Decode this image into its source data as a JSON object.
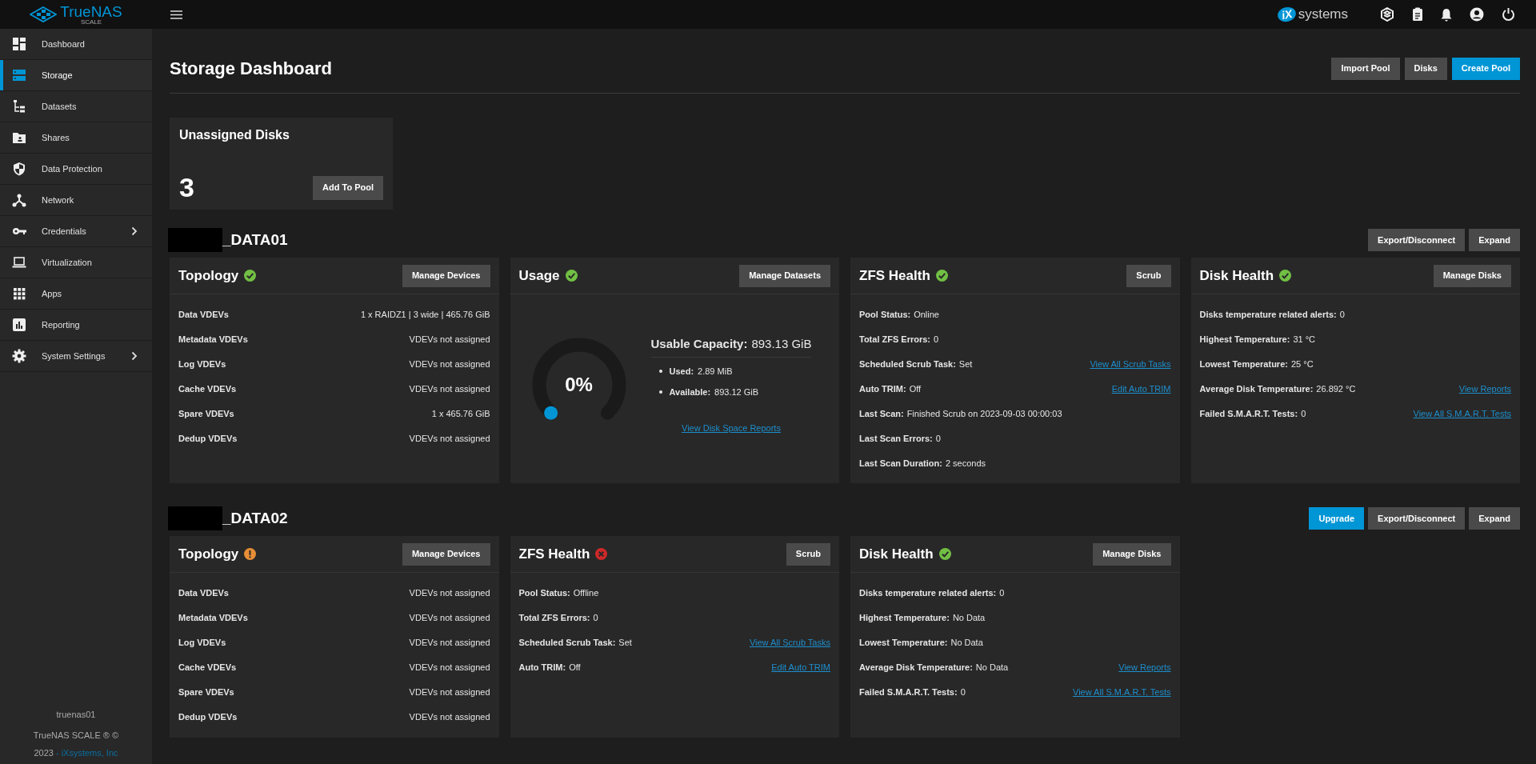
{
  "topbar": {
    "logo": "TrueNAS",
    "logo_sub": "SCALE",
    "vendor_mark": "iX",
    "vendor": "systems"
  },
  "sidebar": {
    "items": [
      {
        "label": "Dashboard",
        "kind": "dashboard",
        "selected": false,
        "has_submenu": false
      },
      {
        "label": "Storage",
        "kind": "storage",
        "selected": true,
        "has_submenu": false
      },
      {
        "label": "Datasets",
        "kind": "datasets",
        "selected": false,
        "has_submenu": false
      },
      {
        "label": "Shares",
        "kind": "shares",
        "selected": false,
        "has_submenu": false
      },
      {
        "label": "Data Protection",
        "kind": "protection",
        "selected": false,
        "has_submenu": false
      },
      {
        "label": "Network",
        "kind": "network",
        "selected": false,
        "has_submenu": false
      },
      {
        "label": "Credentials",
        "kind": "credentials",
        "selected": false,
        "has_submenu": true
      },
      {
        "label": "Virtualization",
        "kind": "virtualization",
        "selected": false,
        "has_submenu": false
      },
      {
        "label": "Apps",
        "kind": "apps",
        "selected": false,
        "has_submenu": false
      },
      {
        "label": "Reporting",
        "kind": "reporting",
        "selected": false,
        "has_submenu": false
      },
      {
        "label": "System Settings",
        "kind": "settings",
        "selected": false,
        "has_submenu": true
      }
    ],
    "hostname": "truenas01",
    "copyright": "TrueNAS SCALE ® ©",
    "year": "2023",
    "company": "- iXsystems, Inc"
  },
  "page": {
    "title": "Storage Dashboard",
    "actions": [
      {
        "label": "Import Pool",
        "primary": false
      },
      {
        "label": "Disks",
        "primary": false
      },
      {
        "label": "Create Pool",
        "primary": true
      }
    ]
  },
  "unassigned": {
    "title": "Unassigned Disks",
    "count": "3",
    "action": "Add To Pool"
  },
  "pools": [
    {
      "name": "_DATA01",
      "redacted": true,
      "actions": [
        {
          "label": "Export/Disconnect",
          "primary": false
        },
        {
          "label": "Expand",
          "primary": false
        }
      ],
      "cards": [
        {
          "kind": "topology",
          "title": "Topology",
          "status": {
            "kind": "ok"
          },
          "button": "Manage Devices",
          "rows": [
            {
              "label": "Data VDEVs",
              "value": "1 x RAIDZ1 | 3 wide | 465.76 GiB"
            },
            {
              "label": "Metadata VDEVs",
              "value": "VDEVs not assigned"
            },
            {
              "label": "Log VDEVs",
              "value": "VDEVs not assigned"
            },
            {
              "label": "Cache VDEVs",
              "value": "VDEVs not assigned"
            },
            {
              "label": "Spare VDEVs",
              "value": "1 x 465.76 GiB"
            },
            {
              "label": "Dedup VDEVs",
              "value": "VDEVs not assigned"
            }
          ]
        },
        {
          "kind": "usage",
          "title": "Usage",
          "status": {
            "kind": "ok"
          },
          "button": "Manage Datasets",
          "gauge": {
            "text": "0%"
          },
          "capacity_label": "Usable Capacity:",
          "capacity": "893.13 GiB",
          "items": [
            {
              "label": "Used:",
              "value": "2.89 MiB"
            },
            {
              "label": "Available:",
              "value": "893.12 GiB"
            }
          ],
          "link": "View Disk Space Reports"
        },
        {
          "kind": "health",
          "title": "ZFS Health",
          "status": {
            "kind": "ok"
          },
          "button": "Scrub",
          "rows": [
            {
              "label": "Pool Status:",
              "value": "Online"
            },
            {
              "label": "Total ZFS Errors:",
              "value": "0"
            },
            {
              "label": "Scheduled Scrub Task:",
              "value": "Set",
              "link": "View All Scrub Tasks"
            },
            {
              "label": "Auto TRIM:",
              "value": "Off",
              "link": "Edit Auto TRIM"
            },
            {
              "label": "Last Scan:",
              "value": "Finished Scrub on 2023-09-03 00:00:03"
            },
            {
              "label": "Last Scan Errors:",
              "value": "0"
            },
            {
              "label": "Last Scan Duration:",
              "value": "2 seconds"
            }
          ]
        },
        {
          "kind": "health",
          "title": "Disk Health",
          "status": {
            "kind": "ok"
          },
          "button": "Manage Disks",
          "rows": [
            {
              "label": "Disks temperature related alerts:",
              "value": "0"
            },
            {
              "label": "Highest Temperature:",
              "value": "31 °C"
            },
            {
              "label": "Lowest Temperature:",
              "value": "25 °C"
            },
            {
              "label": "Average Disk Temperature:",
              "value": "26.892 °C",
              "link": "View Reports"
            },
            {
              "label": "Failed S.M.A.R.T. Tests:",
              "value": "0",
              "link": "View All S.M.A.R.T. Tests"
            }
          ]
        }
      ]
    },
    {
      "name": "_DATA02",
      "redacted": true,
      "actions": [
        {
          "label": "Upgrade",
          "primary": true
        },
        {
          "label": "Export/Disconnect",
          "primary": false
        },
        {
          "label": "Expand",
          "primary": false
        }
      ],
      "cards": [
        {
          "kind": "topology",
          "title": "Topology",
          "status": {
            "kind": "warning"
          },
          "button": "Manage Devices",
          "rows": [
            {
              "label": "Data VDEVs",
              "value": "VDEVs not assigned"
            },
            {
              "label": "Metadata VDEVs",
              "value": "VDEVs not assigned"
            },
            {
              "label": "Log VDEVs",
              "value": "VDEVs not assigned"
            },
            {
              "label": "Cache VDEVs",
              "value": "VDEVs not assigned"
            },
            {
              "label": "Spare VDEVs",
              "value": "VDEVs not assigned"
            },
            {
              "label": "Dedup VDEVs",
              "value": "VDEVs not assigned"
            }
          ]
        },
        {
          "kind": "health",
          "title": "ZFS Health",
          "status": {
            "kind": "error"
          },
          "button": "Scrub",
          "rows": [
            {
              "label": "Pool Status:",
              "value": "Offline"
            },
            {
              "label": "Total ZFS Errors:",
              "value": "0"
            },
            {
              "label": "Scheduled Scrub Task:",
              "value": "Set",
              "link": "View All Scrub Tasks"
            },
            {
              "label": "Auto TRIM:",
              "value": "Off",
              "link": "Edit Auto TRIM"
            }
          ]
        },
        {
          "kind": "health",
          "title": "Disk Health",
          "status": {
            "kind": "ok"
          },
          "button": "Manage Disks",
          "rows": [
            {
              "label": "Disks temperature related alerts:",
              "value": "0"
            },
            {
              "label": "Highest Temperature:",
              "value": "No Data"
            },
            {
              "label": "Lowest Temperature:",
              "value": "No Data"
            },
            {
              "label": "Average Disk Temperature:",
              "value": "No Data",
              "link": "View Reports"
            },
            {
              "label": "Failed S.M.A.R.T. Tests:",
              "value": "0",
              "link": "View All S.M.A.R.T. Tests"
            }
          ]
        }
      ]
    }
  ]
}
